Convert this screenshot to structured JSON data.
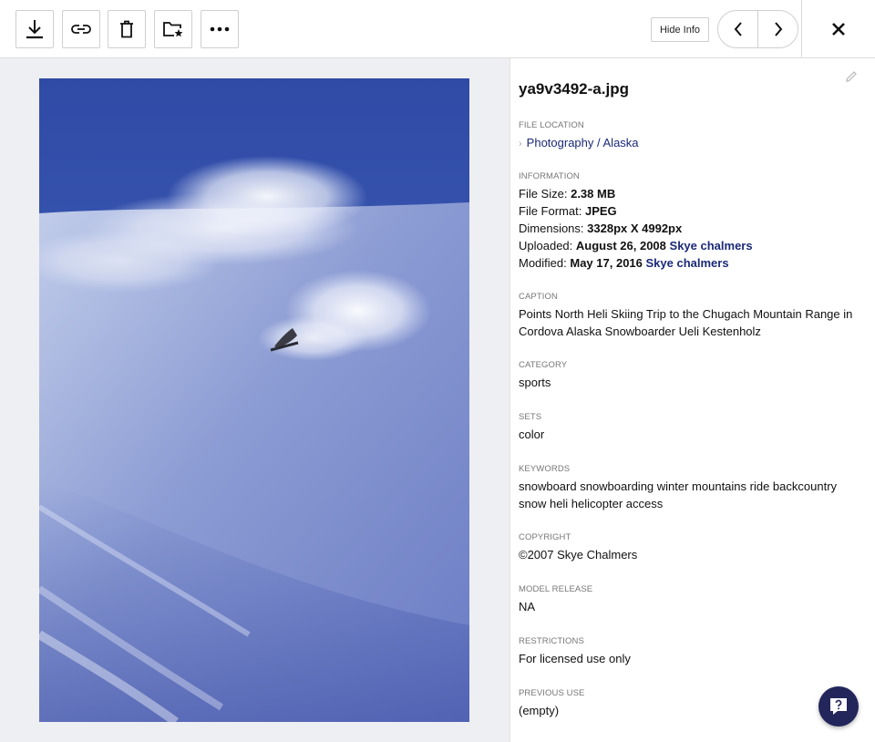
{
  "toolbar": {
    "buttons": [
      {
        "name": "download-button",
        "icon": "download-icon"
      },
      {
        "name": "link-button",
        "icon": "link-icon"
      },
      {
        "name": "delete-button",
        "icon": "trash-icon"
      },
      {
        "name": "add-to-set-button",
        "icon": "folder-star-icon"
      },
      {
        "name": "more-button",
        "icon": "more-icon"
      }
    ],
    "hide_info_label": "Hide Info"
  },
  "info": {
    "file_name": "ya9v3492-a.jpg",
    "file_location": {
      "label": "FILE LOCATION",
      "path": "Photography / Alaska"
    },
    "information": {
      "label": "INFORMATION",
      "file_size_label": "File Size:",
      "file_size": "2.38 MB",
      "file_format_label": "File Format:",
      "file_format": "JPEG",
      "dimensions_label": "Dimensions:",
      "dimensions": "3328px X 4992px",
      "uploaded_label": "Uploaded:",
      "uploaded_date": "August 26, 2008",
      "uploaded_by": "Skye chalmers",
      "modified_label": "Modified:",
      "modified_date": "May 17, 2016",
      "modified_by": "Skye chalmers"
    },
    "caption": {
      "label": "CAPTION",
      "value": "Points North Heli Skiing Trip to the Chugach Mountain Range in Cordova Alaska Snowboarder Ueli Kestenholz"
    },
    "category": {
      "label": "CATEGORY",
      "value": "sports"
    },
    "sets": {
      "label": "SETS",
      "value": "color"
    },
    "keywords": {
      "label": "KEYWORDS",
      "value": "snowboard snowboarding winter mountains ride backcountry snow heli helicopter access"
    },
    "copyright": {
      "label": "COPYRIGHT",
      "value": "©2007 Skye Chalmers"
    },
    "model_release": {
      "label": "MODEL RELEASE",
      "value": "NA"
    },
    "restrictions": {
      "label": "RESTRICTIONS",
      "value": "For licensed use only"
    },
    "previous_use": {
      "label": "PREVIOUS USE",
      "value": "(empty)"
    }
  },
  "colors": {
    "accent_link": "#1b2a78",
    "help_button": "#23265b",
    "preview_bg": "#eeeff3"
  }
}
